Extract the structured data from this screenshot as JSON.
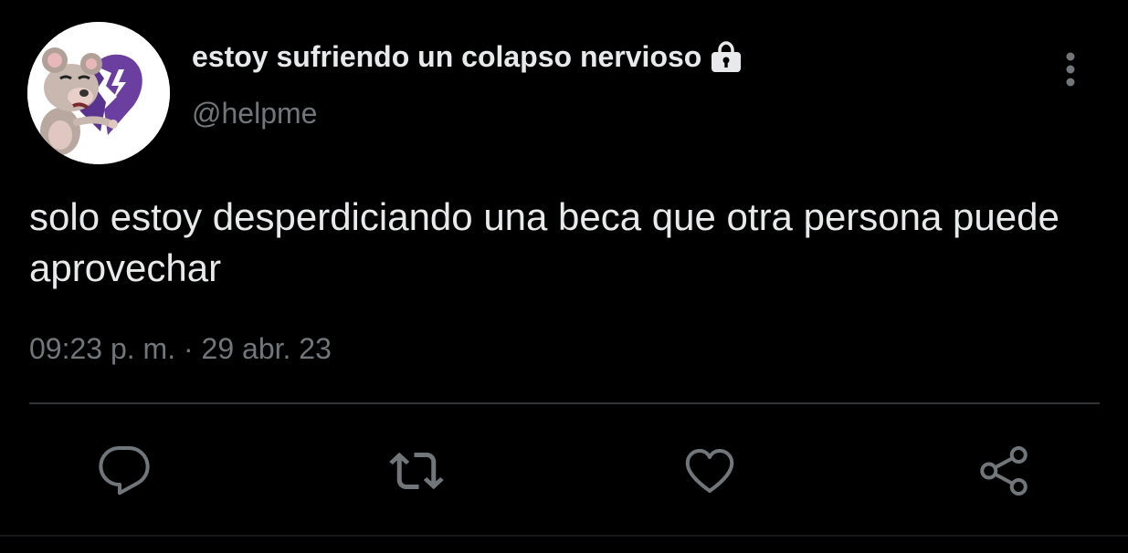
{
  "user": {
    "display_name": "estoy sufriendo un colapso nervioso",
    "handle": "@helpme",
    "protected_icon": "lock-icon",
    "avatar_icon": "mouse-broken-heart-avatar"
  },
  "tweet": {
    "text": "solo estoy desperdiciando una beca que otra persona puede aprovechar",
    "time": "09:23 p. m. · 29 abr. 23"
  },
  "actions": [
    {
      "name": "reply",
      "icon": "reply-icon"
    },
    {
      "name": "retweet",
      "icon": "retweet-icon"
    },
    {
      "name": "like",
      "icon": "like-icon"
    },
    {
      "name": "share",
      "icon": "share-icon"
    }
  ],
  "menu": {
    "icon": "more-options-icon"
  },
  "colors": {
    "background": "#000000",
    "primary_text": "#e7e9ea",
    "secondary_text": "#71767b",
    "icon": "#71767b",
    "divider": "#2f3336",
    "avatar_heart": "#6b3fa0"
  }
}
